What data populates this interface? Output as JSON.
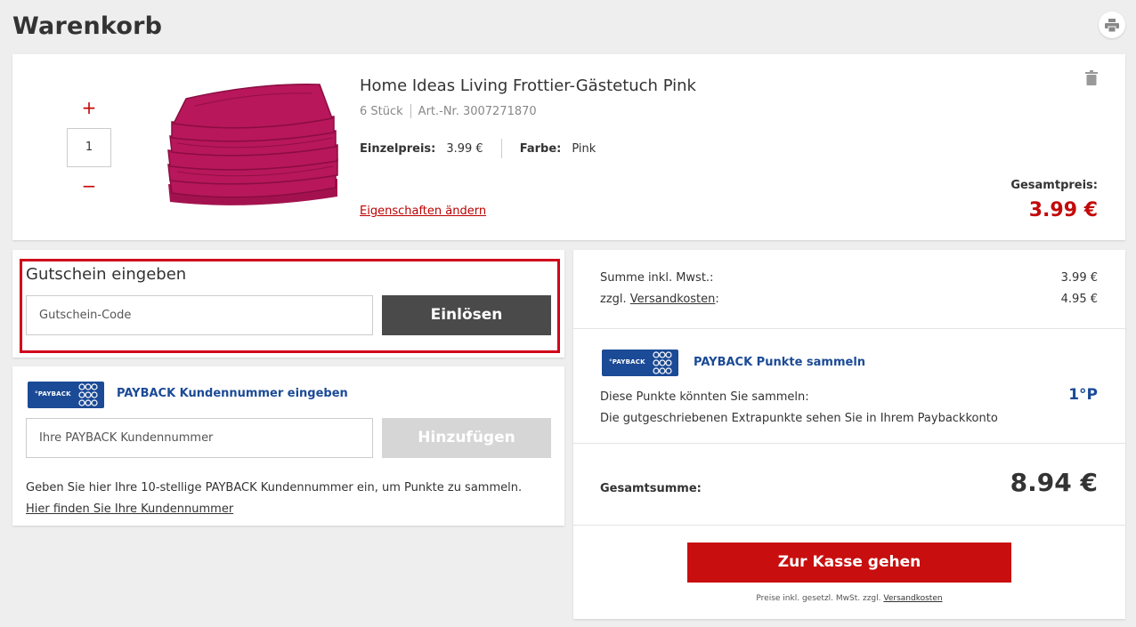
{
  "page": {
    "title": "Warenkorb",
    "print_icon": "printer-icon"
  },
  "product": {
    "qty_plus": "+",
    "qty_minus": "−",
    "quantity": "1",
    "name": "Home Ideas Living Frottier-Gästetuch Pink",
    "pieces": "6 Stück",
    "article_no": "Art.-Nr. 3007271870",
    "unit_price_label": "Einzelpreis:",
    "unit_price": "3.99 €",
    "color_label": "Farbe:",
    "color": "Pink",
    "change_link": "Eigenschaften ändern",
    "total_label": "Gesamtpreis:",
    "total": "3.99 €",
    "delete_icon": "trash-icon",
    "image": "pink-towel-stack"
  },
  "coupon": {
    "title": "Gutschein eingeben",
    "placeholder": "Gutschein-Code",
    "button": "Einlösen"
  },
  "payback_customer": {
    "logo_text": "°PAYBACK",
    "heading": "PAYBACK Kundennummer eingeben",
    "placeholder": "Ihre PAYBACK Kundennummer",
    "button": "Hinzufügen",
    "hint": "Geben Sie hier Ihre 10-stellige PAYBACK Kundennummer ein, um Punkte zu sammeln.",
    "link": "Hier finden Sie Ihre Kundennummer"
  },
  "summary": {
    "subtotal_label": "Summe inkl. Mwst.:",
    "subtotal": "3.99 €",
    "shipping_prefix": "zzgl.",
    "shipping_link": "Versandkosten",
    "shipping_suffix": ":",
    "shipping": "4.95 €",
    "payback_logo_text": "°PAYBACK",
    "payback_heading": "PAYBACK Punkte sammeln",
    "points_text": "Diese Punkte könnten Sie sammeln:",
    "points_value": "1°P",
    "extra_points_text": "Die gutgeschriebenen Extrapunkte sehen Sie in Ihrem Paybackkonto",
    "total_label": "Gesamtsumme:",
    "total": "8.94 €",
    "checkout_button": "Zur Kasse gehen",
    "footnote_prefix": "Preise inkl. gesetzl. MwSt. zzgl.",
    "footnote_link": "Versandkosten"
  },
  "colors": {
    "accent_red": "#c80e0e",
    "payback_blue": "#1b4a96",
    "dark_button": "#4a4a4a"
  }
}
